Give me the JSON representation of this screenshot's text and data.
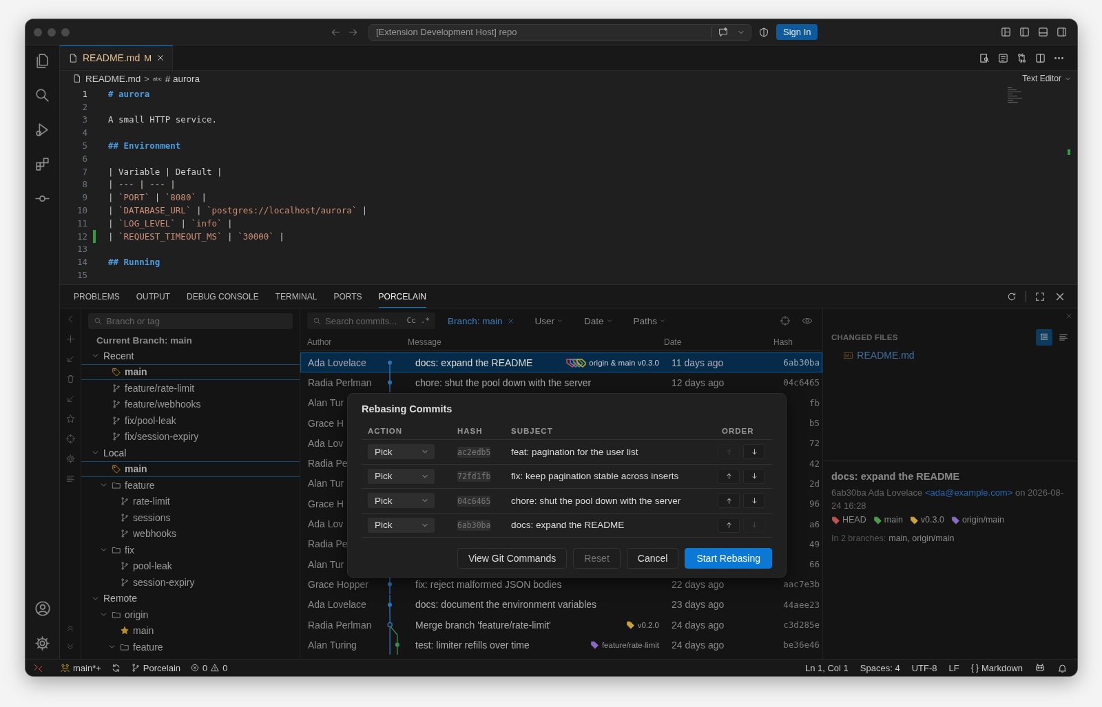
{
  "window": {
    "title": "[Extension Development Host] repo",
    "sign_in": "Sign In"
  },
  "tab": {
    "label": "README.md",
    "status": "M",
    "modified": true
  },
  "breadcrumb": {
    "file": "README.md",
    "separator": ">",
    "symbol": "abc",
    "heading": "# aurora",
    "mode": "Text Editor"
  },
  "editor": {
    "lines": [
      {
        "number": "1",
        "current": true,
        "modified": false,
        "tokens": [
          {
            "kind": "heading",
            "text": "# aurora"
          }
        ]
      },
      {
        "number": "2",
        "current": false,
        "modified": false
      },
      {
        "number": "3",
        "current": false,
        "modified": false,
        "tokens": [
          {
            "kind": "text",
            "text": "A small HTTP service."
          }
        ]
      },
      {
        "number": "4",
        "current": false,
        "modified": false
      },
      {
        "number": "5",
        "current": false,
        "modified": false,
        "tokens": [
          {
            "kind": "heading",
            "text": "## Environment"
          }
        ]
      },
      {
        "number": "6",
        "current": false,
        "modified": false
      },
      {
        "number": "7",
        "current": false,
        "modified": false,
        "tokens": [
          {
            "kind": "text",
            "text": "| Variable | Default |"
          }
        ]
      },
      {
        "number": "8",
        "current": false,
        "modified": false,
        "tokens": [
          {
            "kind": "text",
            "text": "| --- | --- |"
          }
        ]
      },
      {
        "number": "9",
        "current": false,
        "modified": false,
        "tokens": [
          {
            "kind": "text",
            "text": "| "
          },
          {
            "kind": "code",
            "text": "`PORT`"
          },
          {
            "kind": "text",
            "text": " | "
          },
          {
            "kind": "code",
            "text": "`8080`"
          },
          {
            "kind": "text",
            "text": " |"
          }
        ]
      },
      {
        "number": "10",
        "current": false,
        "modified": false,
        "tokens": [
          {
            "kind": "text",
            "text": "| "
          },
          {
            "kind": "code",
            "text": "`DATABASE_URL`"
          },
          {
            "kind": "text",
            "text": " | "
          },
          {
            "kind": "code",
            "text": "`postgres://localhost/aurora`"
          },
          {
            "kind": "text",
            "text": " |"
          }
        ]
      },
      {
        "number": "11",
        "current": false,
        "modified": false,
        "tokens": [
          {
            "kind": "text",
            "text": "| "
          },
          {
            "kind": "code",
            "text": "`LOG_LEVEL`"
          },
          {
            "kind": "text",
            "text": " | "
          },
          {
            "kind": "code",
            "text": "`info`"
          },
          {
            "kind": "text",
            "text": " |"
          }
        ]
      },
      {
        "number": "12",
        "current": false,
        "modified": true,
        "tokens": [
          {
            "kind": "text",
            "text": "| "
          },
          {
            "kind": "code",
            "text": "`REQUEST_TIMEOUT_MS`"
          },
          {
            "kind": "text",
            "text": " | "
          },
          {
            "kind": "code",
            "text": "`30000`"
          },
          {
            "kind": "text",
            "text": " |"
          }
        ]
      },
      {
        "number": "13",
        "current": false,
        "modified": false
      },
      {
        "number": "14",
        "current": false,
        "modified": false,
        "tokens": [
          {
            "kind": "heading",
            "text": "## Running"
          }
        ]
      },
      {
        "number": "15",
        "current": false,
        "modified": false
      }
    ]
  },
  "panel": {
    "tabs": [
      {
        "label": "PROBLEMS",
        "selected": false
      },
      {
        "label": "OUTPUT",
        "selected": false
      },
      {
        "label": "DEBUG CONSOLE",
        "selected": false
      },
      {
        "label": "TERMINAL",
        "selected": false
      },
      {
        "label": "PORTS",
        "selected": false
      },
      {
        "label": "PORCELAIN",
        "selected": true
      }
    ]
  },
  "branches": {
    "placeholder": "Branch or tag",
    "current": "Current Branch: main",
    "tree": [
      {
        "label": "Recent",
        "kind": "group",
        "expanded": true,
        "selected": false,
        "children": [
          {
            "label": "main",
            "kind": "current",
            "selected": true
          },
          {
            "label": "feature/rate-limit",
            "kind": "branch",
            "selected": false
          },
          {
            "label": "feature/webhooks",
            "kind": "branch",
            "selected": false
          },
          {
            "label": "fix/pool-leak",
            "kind": "branch",
            "selected": false
          },
          {
            "label": "fix/session-expiry",
            "kind": "branch",
            "selected": false
          }
        ]
      },
      {
        "label": "Local",
        "kind": "group",
        "expanded": true,
        "selected": false,
        "children": [
          {
            "label": "main",
            "kind": "current",
            "selected": true
          },
          {
            "label": "feature",
            "kind": "folder",
            "expanded": true,
            "selected": false,
            "children": [
              {
                "label": "rate-limit",
                "kind": "branch",
                "selected": false
              },
              {
                "label": "sessions",
                "kind": "branch",
                "selected": false
              },
              {
                "label": "webhooks",
                "kind": "branch",
                "selected": false
              }
            ]
          },
          {
            "label": "fix",
            "kind": "folder",
            "expanded": true,
            "selected": false,
            "children": [
              {
                "label": "pool-leak",
                "kind": "branch",
                "selected": false
              },
              {
                "label": "session-expiry",
                "kind": "branch",
                "selected": false
              }
            ]
          }
        ]
      },
      {
        "label": "Remote",
        "kind": "group",
        "expanded": true,
        "selected": false,
        "children": [
          {
            "label": "origin",
            "kind": "folder",
            "expanded": true,
            "selected": false,
            "children": [
              {
                "label": "main",
                "kind": "starred",
                "selected": false
              },
              {
                "label": "feature",
                "kind": "folder",
                "expanded": true,
                "selected": false
              }
            ]
          }
        ]
      }
    ]
  },
  "commits": {
    "search": {
      "placeholder": "Search commits...",
      "case": "Cc",
      "regex": ".*"
    },
    "filters": [
      {
        "label": "Branch: main",
        "kind": "active"
      },
      {
        "label": "User",
        "kind": "dropdown"
      },
      {
        "label": "Date",
        "kind": "dropdown"
      },
      {
        "label": "Paths",
        "kind": "dropdown"
      }
    ],
    "columns": [
      "Author",
      "Message",
      "Date",
      "Hash"
    ],
    "rows": [
      {
        "author": "Ada Lovelace",
        "message": "docs: expand the README",
        "refs": [
          {
            "label": "origin & main v0.3.0",
            "kind": "multi"
          }
        ],
        "date": "11 days ago",
        "hash": "6ab30ba",
        "kind": "dot",
        "selected": true
      },
      {
        "author": "Radia Perlman",
        "message": "chore: shut the pool down with the server",
        "date": "12 days ago",
        "hash": "04c6465",
        "kind": "dot",
        "selected": false
      },
      {
        "author": "Alan Tur",
        "hash": "fb",
        "selected": false
      },
      {
        "author": "Grace H",
        "hash": "b5",
        "selected": false
      },
      {
        "author": "Ada Lov",
        "hash": "72",
        "selected": false
      },
      {
        "author": "Radia Pe",
        "hash": "42",
        "selected": false
      },
      {
        "author": "Alan Tur",
        "hash": "2d",
        "selected": false
      },
      {
        "author": "Grace H",
        "hash": "96",
        "selected": false
      },
      {
        "author": "Ada Lov",
        "hash": "a6",
        "selected": false
      },
      {
        "author": "Radia Pe",
        "hash": "49",
        "selected": false
      },
      {
        "author": "Alan Tur",
        "hash": "66",
        "selected": false
      },
      {
        "author": "Grace Hopper",
        "message": "fix: reject malformed JSON bodies",
        "date": "22 days ago",
        "hash": "aac7e3b",
        "kind": "dot",
        "selected": false
      },
      {
        "author": "Ada Lovelace",
        "message": "docs: document the environment variables",
        "date": "23 days ago",
        "hash": "44aee23",
        "kind": "dot",
        "selected": false
      },
      {
        "author": "Radia Perlman",
        "message": "Merge branch 'feature/rate-limit'",
        "refs": [
          {
            "label": "v0.2.0",
            "kind": "tag",
            "color": "#c8a23c"
          }
        ],
        "date": "24 days ago",
        "hash": "c3d285e",
        "kind": "merge",
        "selected": false
      },
      {
        "author": "Alan Turing",
        "message": "test: limiter refills over time",
        "refs": [
          {
            "label": "feature/rate-limit",
            "kind": "tag",
            "color": "#8a6bc4"
          }
        ],
        "date": "24 days ago",
        "hash": "be36e46",
        "kind": "side",
        "selected": false
      }
    ]
  },
  "rebase_dialog": {
    "title": "Rebasing Commits",
    "columns": [
      "ACTION",
      "HASH",
      "SUBJECT",
      "ORDER"
    ],
    "rows": [
      {
        "action": "Pick",
        "hash": "ac2edb5",
        "subject": "feat: pagination for the user list",
        "up_disabled": true,
        "down_disabled": false
      },
      {
        "action": "Pick",
        "hash": "72fd1fb",
        "subject": "fix: keep pagination stable across inserts",
        "up_disabled": false,
        "down_disabled": false
      },
      {
        "action": "Pick",
        "hash": "04c6465",
        "subject": "chore: shut the pool down with the server",
        "up_disabled": false,
        "down_disabled": false
      },
      {
        "action": "Pick",
        "hash": "6ab30ba",
        "subject": "docs: expand the README",
        "up_disabled": false,
        "down_disabled": true
      }
    ],
    "buttons": [
      {
        "label": "View Git Commands",
        "kind": "secondary",
        "disabled": false
      },
      {
        "label": "Reset",
        "kind": "secondary",
        "disabled": true
      },
      {
        "label": "Cancel",
        "kind": "secondary",
        "disabled": false
      },
      {
        "label": "Start Rebasing",
        "kind": "primary",
        "disabled": false
      }
    ]
  },
  "details": {
    "heading": "CHANGED FILES",
    "files": [
      {
        "badge": "M↓",
        "name": "README.md"
      }
    ],
    "commit": {
      "title": "docs: expand the README",
      "meta_before": "6ab30ba Ada Lovelace",
      "email": "<ada@example.com>",
      "meta_after": "on 2026-08-24 16:28",
      "refs": [
        {
          "label": "HEAD",
          "color": "#c0524f"
        },
        {
          "label": "main",
          "color": "#4e9a4e"
        },
        {
          "label": "v0.3.0",
          "color": "#c8a23c"
        },
        {
          "label": "origin/main",
          "color": "#8a6bc4"
        }
      ],
      "branches_label": "In 2 branches:",
      "branches": "main, origin/main"
    }
  },
  "status_bar": {
    "branch": "main*+",
    "scm": "Porcelain",
    "errors": "0",
    "warnings": "0",
    "position": "Ln 1, Col 1",
    "spaces": "Spaces: 4",
    "encoding": "UTF-8",
    "eol": "LF",
    "language": "Markdown",
    "language_icon": "{ }"
  }
}
